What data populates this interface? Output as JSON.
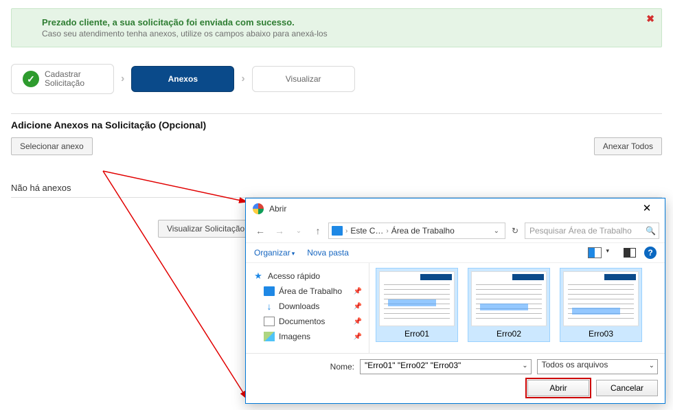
{
  "banner": {
    "title": "Prezado cliente, a sua solicitação foi enviada com sucesso.",
    "subtitle": "Caso seu atendimento tenha anexos, utilize os campos abaixo para anexá-los",
    "close_glyph": "✖"
  },
  "steps": {
    "cadastrar_line1": "Cadastrar",
    "cadastrar_line2": "Solicitação",
    "anexos": "Anexos",
    "visualizar": "Visualizar",
    "check_glyph": "✓",
    "sep_glyph": "›"
  },
  "section_heading": "Adicione Anexos na Solicitação (Opcional)",
  "buttons": {
    "selecionar_anexo": "Selecionar anexo",
    "anexar_todos": "Anexar Todos",
    "visualizar_solicitacao": "Visualizar Solicitação"
  },
  "no_attachments": "Não há anexos",
  "dialog": {
    "title": "Abrir",
    "close_glyph": "✕",
    "nav_back": "←",
    "nav_forward": "→",
    "nav_up": "↑",
    "breadcrumb_root": "Este C…",
    "breadcrumb_leaf": "Área de Trabalho",
    "bc_sep": "›",
    "bc_drop_glyph": "⌄",
    "refresh_glyph": "↻",
    "search_placeholder": "Pesquisar Área de Trabalho",
    "search_glyph": "🔍",
    "organize": "Organizar",
    "nova_pasta": "Nova pasta",
    "help_glyph": "?",
    "tree": {
      "quick": "Acesso rápido",
      "desktop": "Área de Trabalho",
      "downloads": "Downloads",
      "documents": "Documentos",
      "images": "Imagens",
      "down_glyph": "↓",
      "pin_glyph": "📌"
    },
    "files": [
      {
        "name": "Erro01",
        "selected": true
      },
      {
        "name": "Erro02",
        "selected": true
      },
      {
        "name": "Erro03",
        "selected": true
      }
    ],
    "name_label": "Nome:",
    "name_value": "\"Erro01\" \"Erro02\" \"Erro03\"",
    "filter_value": "Todos os arquivos",
    "drop_glyph": "⌄",
    "open_btn": "Abrir",
    "cancel_btn": "Cancelar"
  }
}
